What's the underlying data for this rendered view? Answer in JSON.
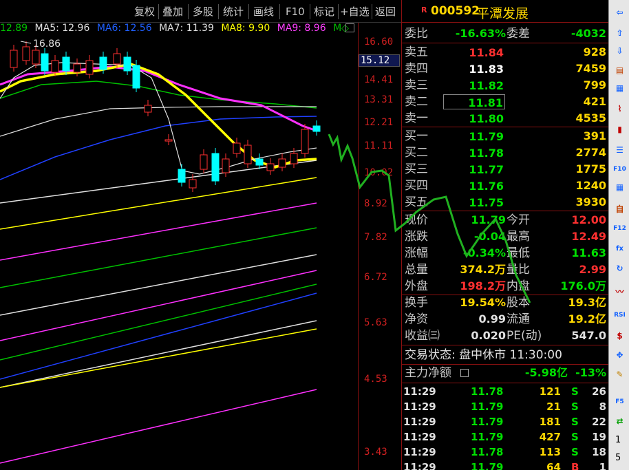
{
  "toolbar": {
    "buttons": [
      "复权",
      "叠加",
      "多股",
      "统计",
      "画线",
      "F10",
      "标记",
      "+自选",
      "返回"
    ]
  },
  "ma_bar": {
    "ma_first": "12.89",
    "ma5": "MA5: 12.96",
    "ma6": "MA6: 12.56",
    "ma7": "MA7: 11.39",
    "ma8": "MA8: 9.90",
    "ma9": "MA9: 8.96"
  },
  "chart": {
    "high_label": "16.86",
    "axis_ticks": [
      "16.60",
      "14.41",
      "13.31",
      "12.21",
      "11.11",
      "10.02",
      "8.92",
      "7.82",
      "6.72",
      "5.63",
      "4.53",
      "3.43"
    ],
    "highlight_price": "15.12",
    "colors": {
      "up": "#ff3030",
      "down": "#00ffff",
      "ma_white": "#e0e0e0",
      "ma_yellow": "#ffff00",
      "ma_magenta": "#ff30ff",
      "ma_green": "#00c000",
      "ma_blue": "#2040ff"
    }
  },
  "stock": {
    "badge": "R",
    "code": "000592",
    "name": "平潭发展"
  },
  "ratio": {
    "label1": "委比",
    "value1": "-16.63%",
    "label2": "委差",
    "value2": "-4032"
  },
  "asks": [
    {
      "label": "卖五",
      "price": "11.84",
      "vol": "928"
    },
    {
      "label": "卖四",
      "price": "11.83",
      "vol": "7459"
    },
    {
      "label": "卖三",
      "price": "11.82",
      "vol": "799"
    },
    {
      "label": "卖二",
      "price": "11.81",
      "vol": "421"
    },
    {
      "label": "卖一",
      "price": "11.80",
      "vol": "4535"
    }
  ],
  "bids": [
    {
      "label": "买一",
      "price": "11.79",
      "vol": "391"
    },
    {
      "label": "买二",
      "price": "11.78",
      "vol": "2774"
    },
    {
      "label": "买三",
      "price": "11.77",
      "vol": "1775"
    },
    {
      "label": "买四",
      "price": "11.76",
      "vol": "1240"
    },
    {
      "label": "买五",
      "price": "11.75",
      "vol": "3930"
    }
  ],
  "quote": [
    {
      "l1": "现价",
      "v1": "11.79",
      "l2": "今开",
      "v2": "12.00"
    },
    {
      "l1": "涨跌",
      "v1": "-0.04",
      "l2": "最高",
      "v2": "12.49"
    },
    {
      "l1": "涨幅",
      "v1": "-0.34%",
      "l2": "最低",
      "v2": "11.63"
    },
    {
      "l1": "总量",
      "v1": "374.2万",
      "l2": "量比",
      "v2": "2.99"
    },
    {
      "l1": "外盘",
      "v1": "198.2万",
      "l2": "内盘",
      "v2": "176.0万"
    }
  ],
  "fund": [
    {
      "l1": "换手",
      "v1": "19.54%",
      "l2": "股本",
      "v2": "19.3亿"
    },
    {
      "l1": "净资",
      "v1": "0.99",
      "l2": "流通",
      "v2": "19.2亿"
    },
    {
      "l1": "收益㈢",
      "v1": "0.020",
      "l2": "PE(动)",
      "v2": "547.0"
    }
  ],
  "status": {
    "text": "交易状态: 盘中休市 11:30:00"
  },
  "mainflow": {
    "label": "主力净额",
    "value": "-5.98亿",
    "pct": "-13%"
  },
  "trades": [
    {
      "time": "11:29",
      "price": "11.78",
      "vol": "121",
      "side": "S",
      "n": "26"
    },
    {
      "time": "11:29",
      "price": "11.79",
      "vol": "21",
      "side": "S",
      "n": "8"
    },
    {
      "time": "11:29",
      "price": "11.79",
      "vol": "181",
      "side": "S",
      "n": "22"
    },
    {
      "time": "11:29",
      "price": "11.79",
      "vol": "427",
      "side": "S",
      "n": "19"
    },
    {
      "time": "11:29",
      "price": "11.78",
      "vol": "113",
      "side": "S",
      "n": "18"
    },
    {
      "time": "11:29",
      "price": "11.79",
      "vol": "64",
      "side": "B",
      "n": "1"
    }
  ],
  "sidebar": {
    "nums": [
      "1",
      "5"
    ]
  }
}
